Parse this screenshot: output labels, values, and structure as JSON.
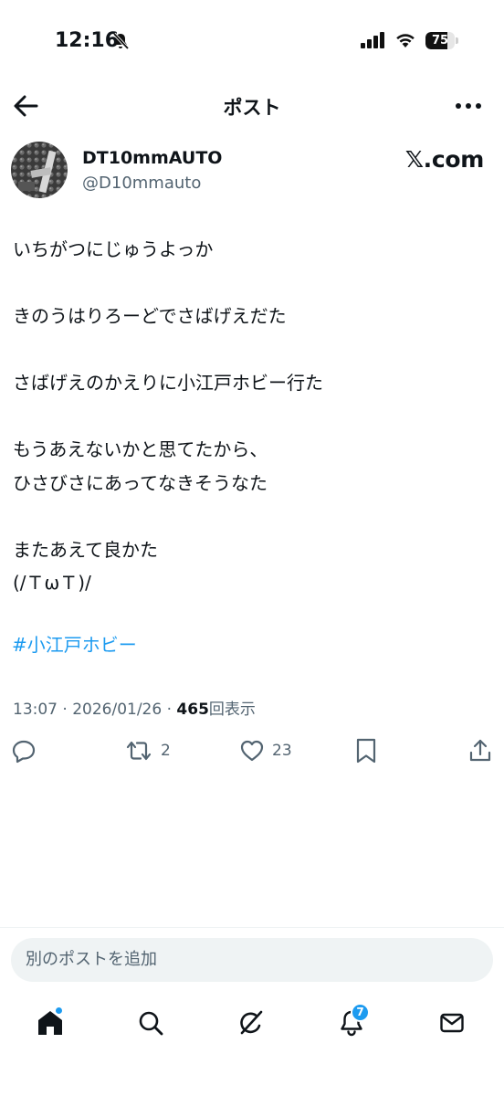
{
  "status_bar": {
    "time": "12:16",
    "battery_level": "75"
  },
  "header": {
    "title": "ポスト"
  },
  "author": {
    "name": "DT10mmAUTO",
    "handle": "@D10mmauto",
    "source_badge": "𝕏.com"
  },
  "post": {
    "lines": [
      "いちがつにじゅうよっか",
      "",
      "きのうはりろーどでさばげえだた",
      "",
      "さばげえのかえりに小江戸ホビー行た",
      "",
      "もうあえないかと思てたから、",
      "ひさびさにあってなきそうなた",
      "",
      "またあえて良かた",
      "(/ＴωＴ)/"
    ],
    "hashtag": "#小江戸ホビー",
    "timestamp": "13:07 · 2026/01/26 · ",
    "views_count": "465",
    "views_label": "回表示"
  },
  "actions": {
    "reply": {
      "icon": "reply-icon"
    },
    "repost": {
      "icon": "repost-icon",
      "count": "2"
    },
    "like": {
      "icon": "heart-icon",
      "count": "23"
    },
    "bookmark": {
      "icon": "bookmark-icon"
    },
    "share": {
      "icon": "share-icon"
    }
  },
  "reply_box": {
    "placeholder": "別のポストを追加"
  },
  "tab_bar": {
    "notifications_badge": "7",
    "items": [
      "home-icon",
      "search-icon",
      "grok-icon",
      "bell-icon",
      "mail-icon"
    ]
  },
  "colors": {
    "accent": "#1d9bf0",
    "text": "#0f1419",
    "secondary": "#536471"
  }
}
